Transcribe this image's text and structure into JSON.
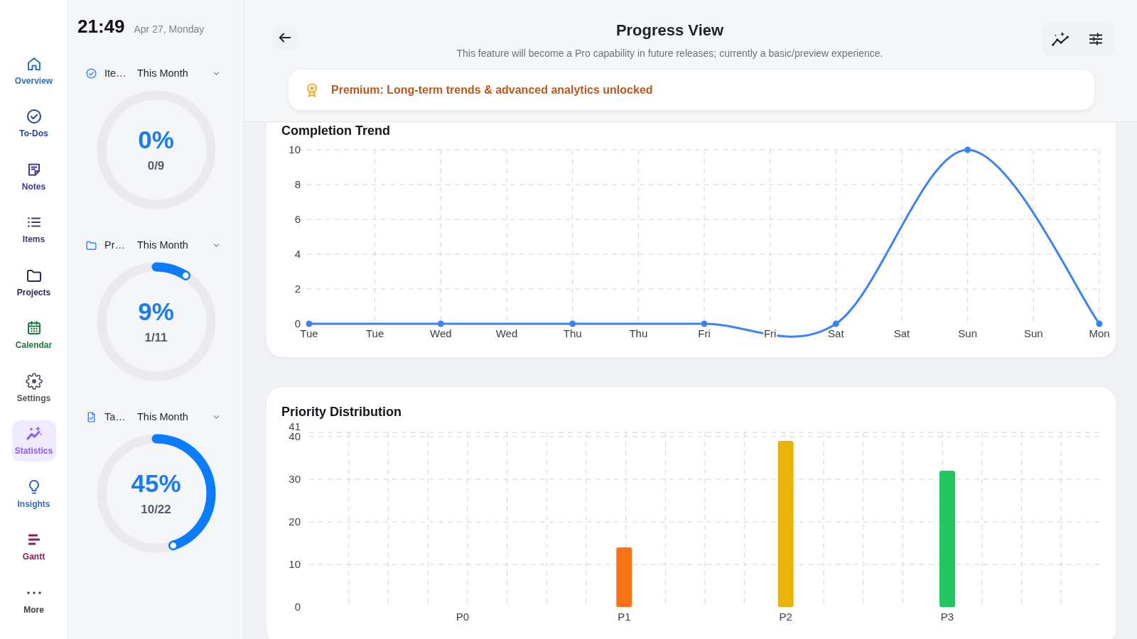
{
  "nav": [
    {
      "label": "Overview",
      "color": "#2b72b5",
      "selected": false
    },
    {
      "label": "To-Dos",
      "color": "#283f9c",
      "selected": false
    },
    {
      "label": "Notes",
      "color": "#3d3a91",
      "selected": false
    },
    {
      "label": "Items",
      "color": "#3e3c6b",
      "selected": false
    },
    {
      "label": "Projects",
      "color": "#29275a",
      "selected": false
    },
    {
      "label": "Calendar",
      "color": "#1f7a3f",
      "selected": false
    },
    {
      "label": "Settings",
      "color": "#53545c",
      "selected": false
    },
    {
      "label": "Statistics",
      "color": "#8b5cf6",
      "selected": true
    },
    {
      "label": "Insights",
      "color": "#2e6bc6",
      "selected": false
    },
    {
      "label": "Gantt",
      "color": "#8b1e57",
      "selected": false
    },
    {
      "label": "More",
      "color": "#3f3f46",
      "selected": false
    }
  ],
  "clock": {
    "time": "21:49",
    "date": "Apr 27, Monday"
  },
  "gauges": [
    {
      "label": "Ite…",
      "period": "This Month",
      "percent": "0%",
      "count": "0/9",
      "level": 0
    },
    {
      "label": "Pr…",
      "period": "This Month",
      "percent": "9%",
      "count": "1/11",
      "level": 0.09
    },
    {
      "label": "Ta…",
      "period": "This Month",
      "percent": "45%",
      "count": "10/22",
      "level": 0.45
    }
  ],
  "header": {
    "title": "Progress View",
    "subtitle": "This feature will become a Pro capability in future releases; currently a basic/preview experience.",
    "banner": "Premium: Long-term trends & advanced analytics unlocked"
  },
  "cards": [
    {
      "chart_data": {
        "type": "line",
        "title": "Completion Trend",
        "categories": [
          "Tue",
          "Tue",
          "Wed",
          "Wed",
          "Thu",
          "Thu",
          "Fri",
          "Fri",
          "Sat",
          "Sat",
          "Sun",
          "Sun",
          "Mon"
        ],
        "values": [
          0,
          null,
          0,
          null,
          0,
          null,
          0,
          null,
          0,
          null,
          10,
          null,
          0
        ],
        "color": "#3b82f6",
        "yticks": [
          0,
          2,
          4,
          6,
          8,
          10
        ],
        "ylim": [
          0,
          10
        ],
        "grid": true,
        "marker": "circle"
      }
    },
    {
      "chart_data": {
        "type": "bar",
        "title": "Priority Distribution",
        "categories": [
          "P0",
          "P1",
          "P2",
          "P3"
        ],
        "values": [
          0,
          14,
          39,
          32
        ],
        "colors": [
          null,
          "#f97316",
          "#eab308",
          "#22c55e"
        ],
        "yticks": [
          0,
          10,
          20,
          30,
          40,
          41
        ],
        "ylim": [
          0,
          41
        ],
        "grid": true
      }
    }
  ]
}
